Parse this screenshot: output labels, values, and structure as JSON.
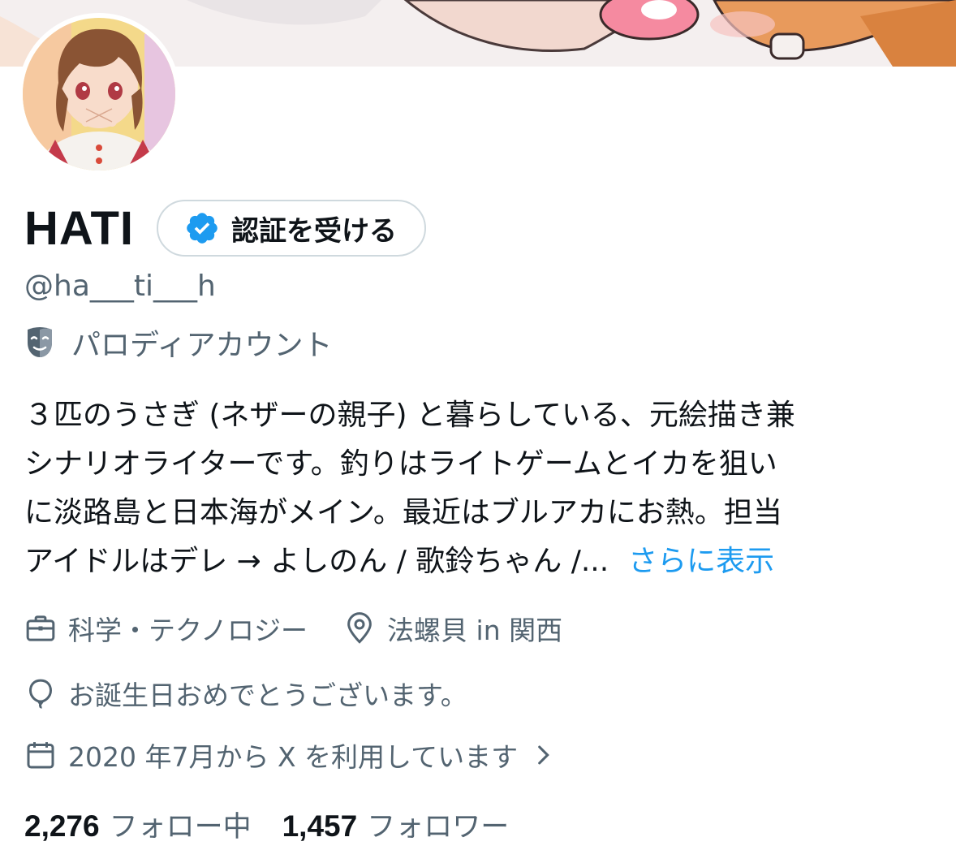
{
  "profile": {
    "display_name": "HATI",
    "verify_button_label": "認証を受ける",
    "handle": "@ha___ti___h",
    "parody_label": "パロディアカウント"
  },
  "bio": {
    "lines": [
      "３匹のうさぎ (ネザーの親子) と暮らしている、元絵描き兼",
      "シナリオライターです。釣りはライトゲームとイカを狙い",
      "に淡路島と日本海がメイン。最近はブルアカにお熱。担当",
      "アイドルはデレ → よしのん / 歌鈴ちゃん /..."
    ],
    "show_more": "さらに表示"
  },
  "meta": {
    "category": "科学・テクノロジー",
    "location": "法螺貝 in 関西",
    "birthday": "お誕生日おめでとうございます。",
    "joined": "2020 年7月から X を利用しています"
  },
  "stats": {
    "following_count": "2,276",
    "following_label": "フォロー中",
    "followers_count": "1,457",
    "followers_label": "フォロワー"
  },
  "icons": {
    "verified": "verified-badge-icon",
    "parody": "parody-mask-icon",
    "category": "briefcase-icon",
    "location": "location-pin-icon",
    "birthday": "balloon-icon",
    "joined": "calendar-icon",
    "joined_arrow": "chevron-right-icon"
  },
  "colors": {
    "accent": "#1d9bf0",
    "secondary_text": "#536471",
    "primary_text": "#0f1419",
    "border": "#cfd9de"
  }
}
